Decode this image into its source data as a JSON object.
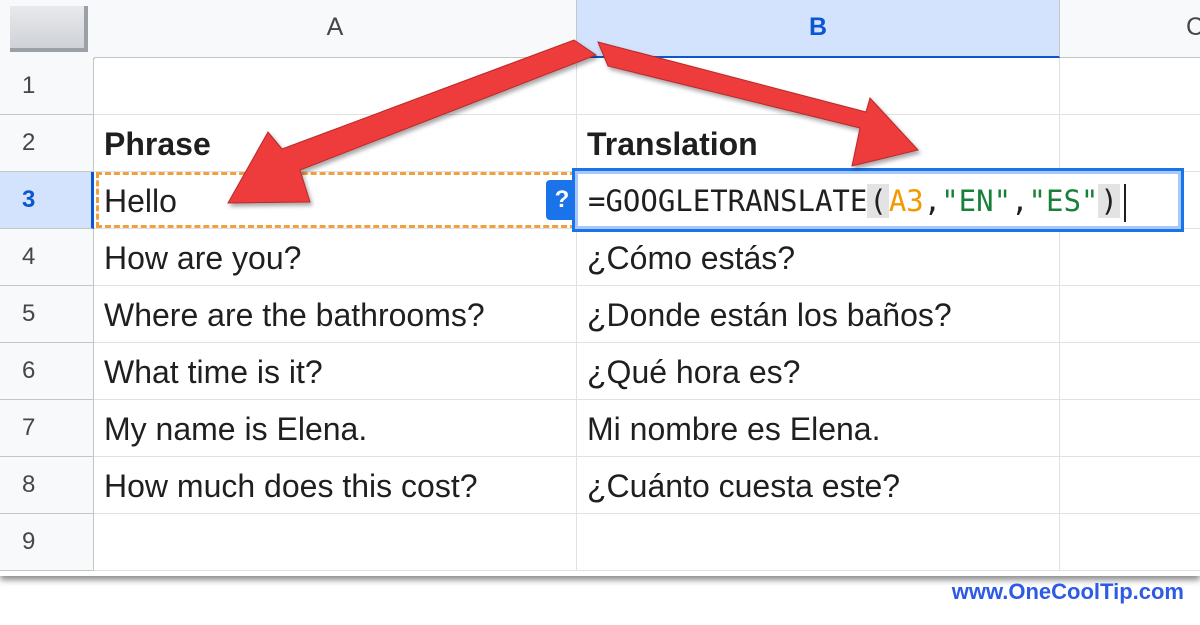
{
  "columns": [
    {
      "label": "A",
      "selected": false
    },
    {
      "label": "B",
      "selected": true
    },
    {
      "label": "C",
      "selected": false
    }
  ],
  "rows": [
    {
      "num": "1",
      "a": "",
      "b": ""
    },
    {
      "num": "2",
      "a": "Phrase",
      "b": "Translation"
    },
    {
      "num": "3",
      "a": "Hello",
      "b": ""
    },
    {
      "num": "4",
      "a": "How are you?",
      "b": "¿Cómo estás?"
    },
    {
      "num": "5",
      "a": "Where are the bathrooms?",
      "b": "¿Donde están los baños?"
    },
    {
      "num": "6",
      "a": "What time is it?",
      "b": "¿Qué hora es?"
    },
    {
      "num": "7",
      "a": "My name is Elena.",
      "b": "Mi nombre es Elena."
    },
    {
      "num": "8",
      "a": "How much does this cost?",
      "b": "¿Cuánto cuesta este?"
    },
    {
      "num": "9",
      "a": "",
      "b": ""
    }
  ],
  "active_row": "3",
  "formula": {
    "prefix": "=GOOGLETRANSLATE",
    "open_paren": "(",
    "ref": "A3",
    "sep1": ",",
    "arg1": "\"EN\"",
    "sep2": ",",
    "arg2": "\"ES\"",
    "close_paren": ")"
  },
  "help_badge": "?",
  "watermark": "www.OneCoolTip.com",
  "colors": {
    "selection_blue": "#1a73e8",
    "header_selected": "#d3e3fd",
    "reference_orange": "#f0a040",
    "string_green": "#188038",
    "arrow_red": "#ee3b3b"
  }
}
